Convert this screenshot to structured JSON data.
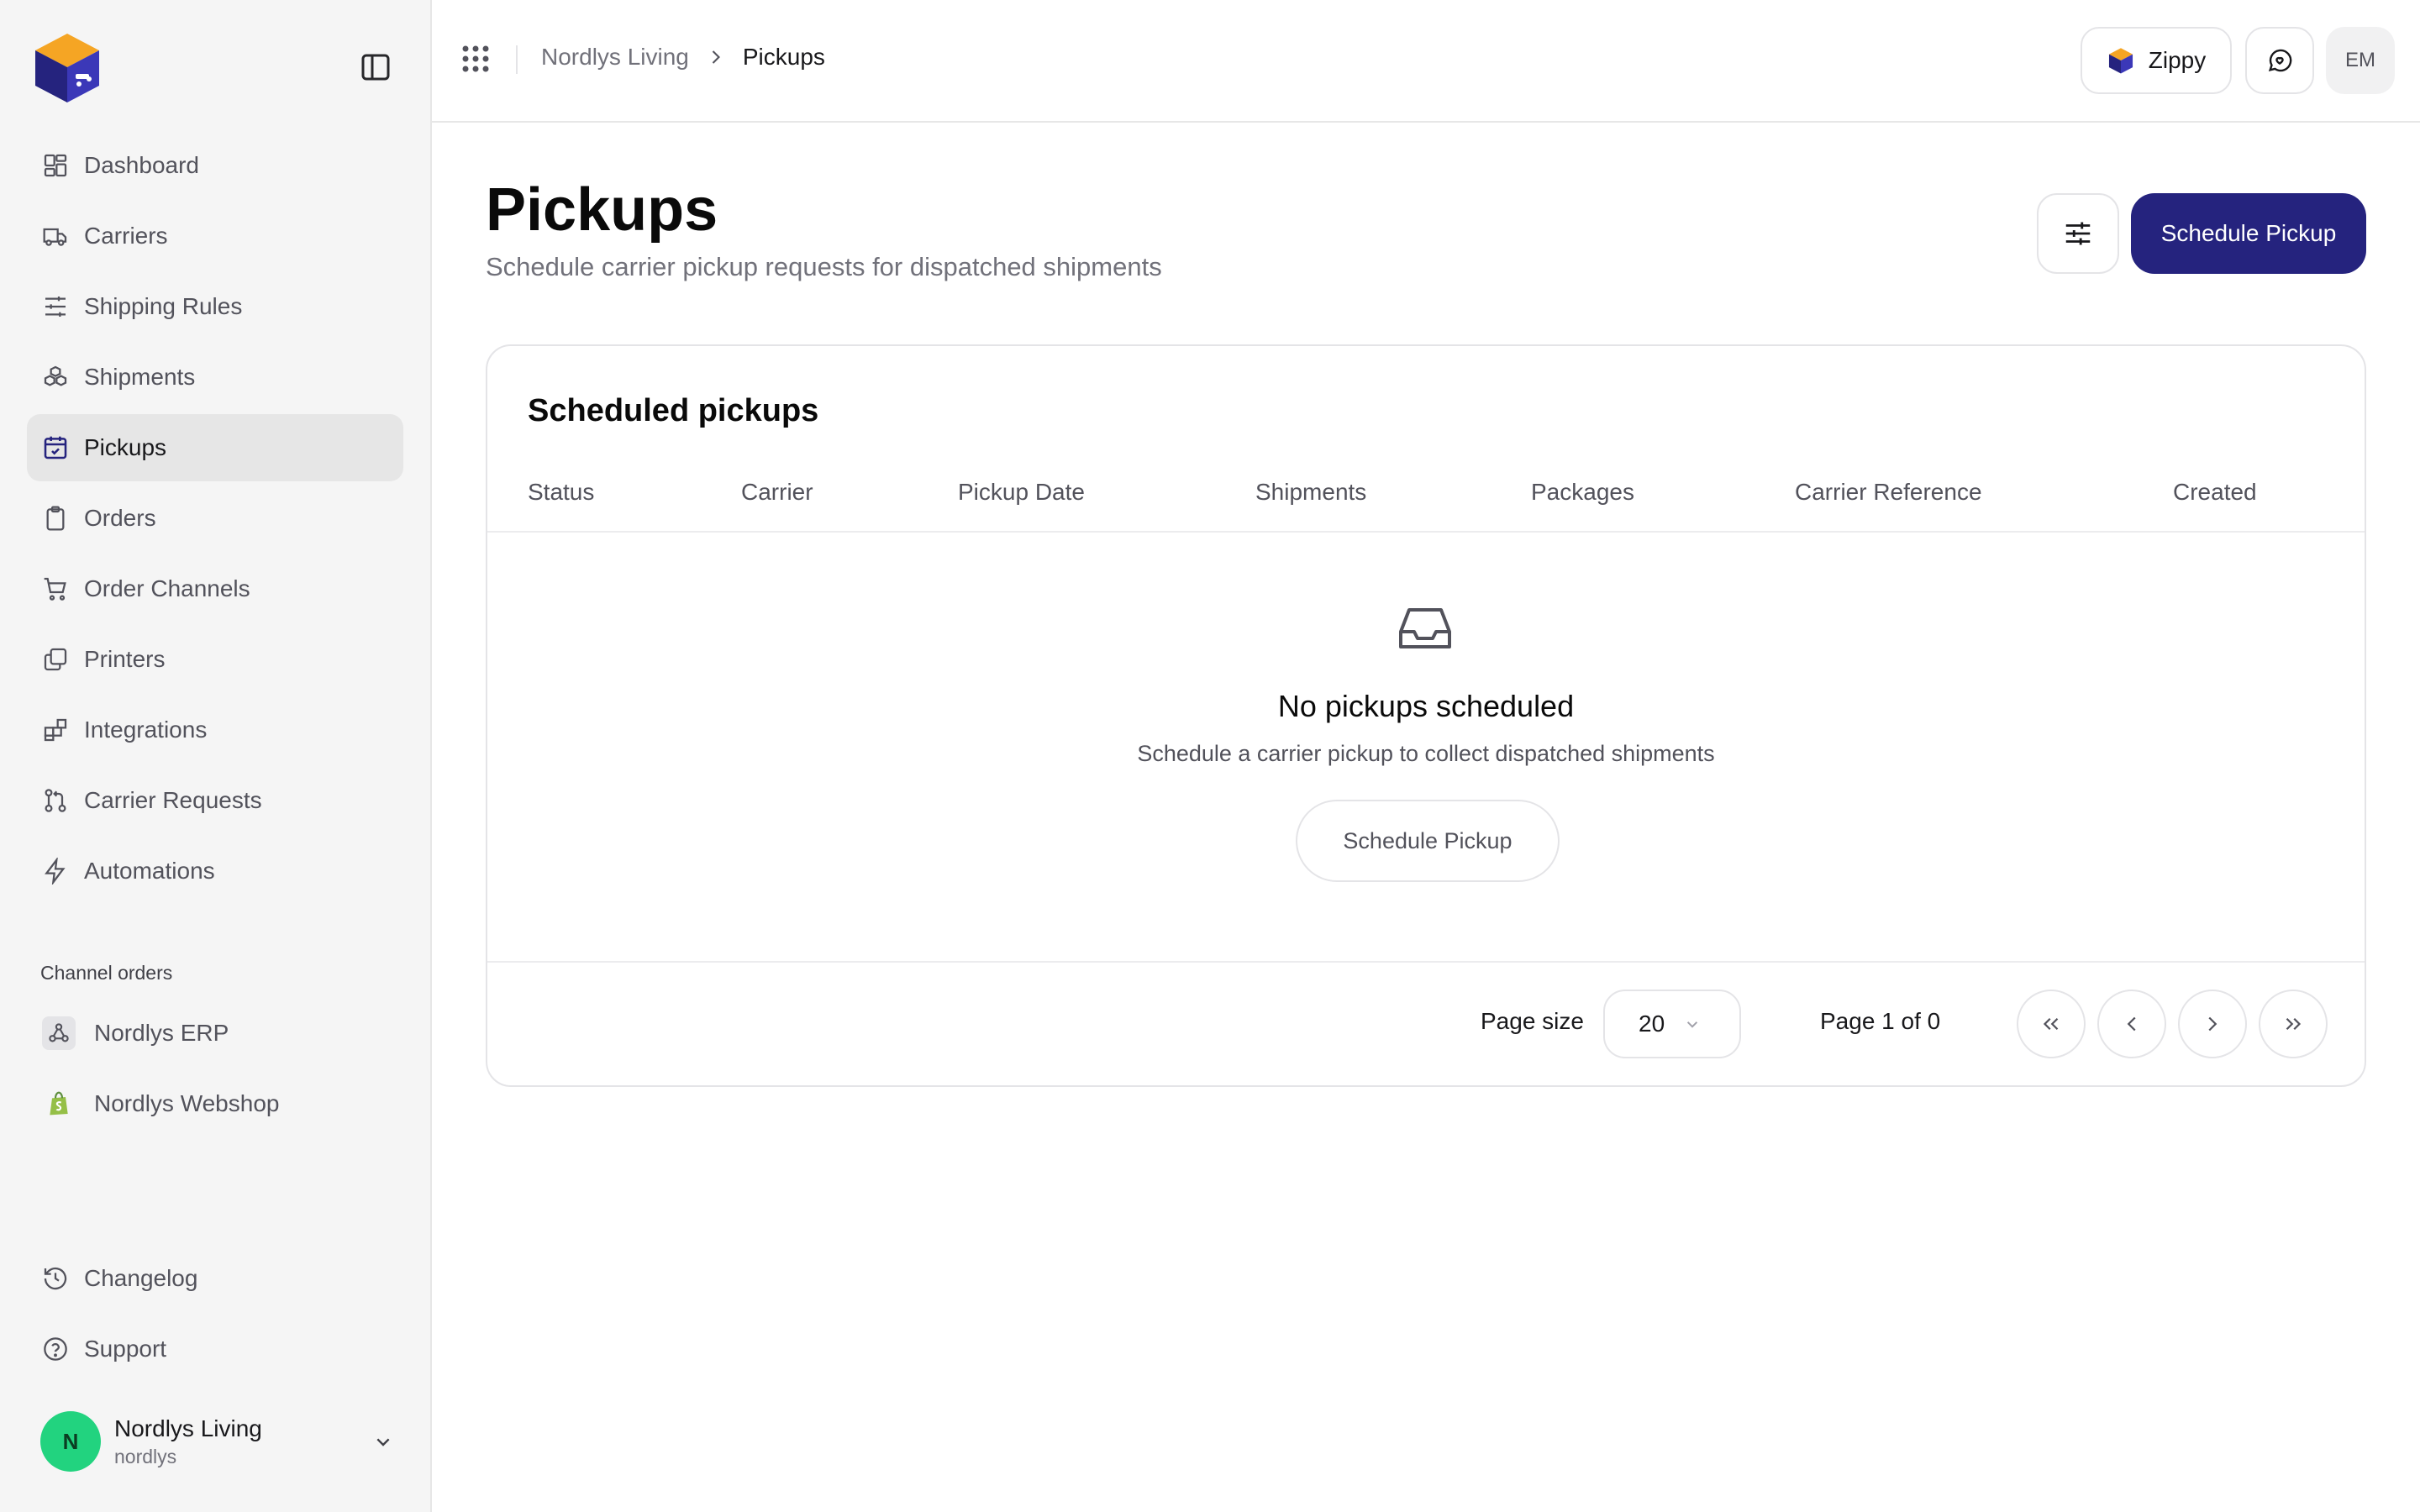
{
  "app": {
    "brand_color": "#25237e",
    "logo_icon": "box-truck-logo"
  },
  "sidebar": {
    "items": [
      {
        "label": "Dashboard",
        "icon": "layout-dashboard-icon"
      },
      {
        "label": "Carriers",
        "icon": "truck-icon"
      },
      {
        "label": "Shipping Rules",
        "icon": "sliders-icon"
      },
      {
        "label": "Shipments",
        "icon": "boxes-icon"
      },
      {
        "label": "Pickups",
        "icon": "calendar-check-icon",
        "active": true
      },
      {
        "label": "Orders",
        "icon": "clipboard-icon"
      },
      {
        "label": "Order Channels",
        "icon": "shopping-cart-icon"
      },
      {
        "label": "Printers",
        "icon": "copy-icon"
      },
      {
        "label": "Integrations",
        "icon": "blocks-icon"
      },
      {
        "label": "Carrier Requests",
        "icon": "git-pull-request-icon"
      },
      {
        "label": "Automations",
        "icon": "zap-icon"
      }
    ],
    "section_label": "Channel orders",
    "channels": [
      {
        "label": "Nordlys ERP",
        "icon": "webhook-icon"
      },
      {
        "label": "Nordlys Webshop",
        "icon": "shopify-icon"
      }
    ],
    "bottom_items": [
      {
        "label": "Changelog",
        "icon": "history-icon"
      },
      {
        "label": "Support",
        "icon": "help-circle-icon"
      }
    ],
    "user": {
      "initial": "N",
      "name": "Nordlys Living",
      "handle": "nordlys",
      "avatar_color": "#22d37f"
    }
  },
  "topbar": {
    "breadcrumb": [
      "Nordlys Living",
      "Pickups"
    ],
    "zippy_label": "Zippy",
    "user_initials": "EM"
  },
  "page": {
    "title": "Pickups",
    "subtitle": "Schedule carrier pickup requests for dispatched shipments",
    "primary_action": "Schedule Pickup"
  },
  "table": {
    "title": "Scheduled pickups",
    "columns": [
      "Status",
      "Carrier",
      "Pickup Date",
      "Shipments",
      "Packages",
      "Carrier Reference",
      "Created"
    ],
    "rows": [],
    "empty": {
      "title": "No pickups scheduled",
      "description": "Schedule a carrier pickup to collect dispatched shipments",
      "action": "Schedule Pickup"
    },
    "pagination": {
      "page_size_label": "Page size",
      "page_size": "20",
      "page_info": "Page 1 of 0"
    }
  }
}
